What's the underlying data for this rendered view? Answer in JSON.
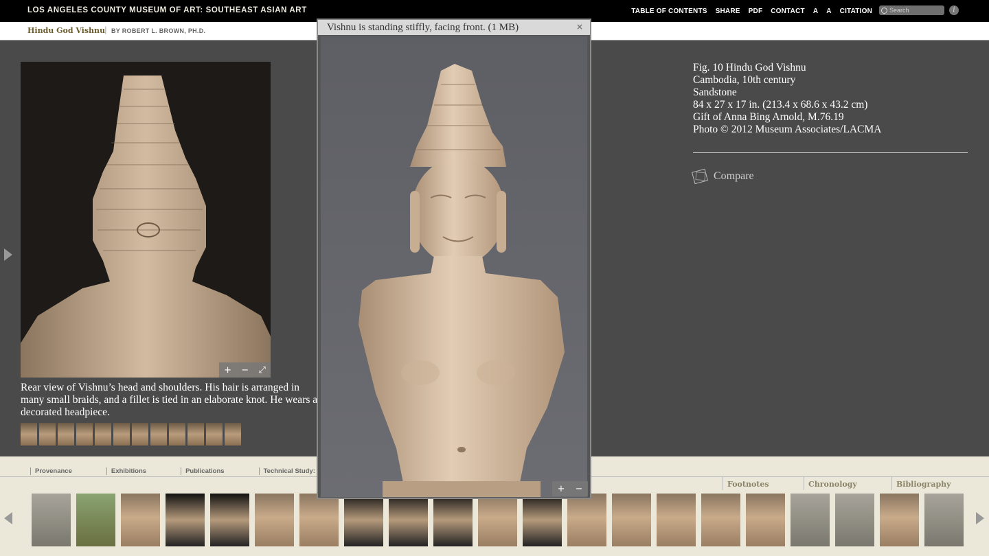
{
  "topbar": {
    "site_title": "LOS ANGELES COUNTY MUSEUM OF ART: SOUTHEAST ASIAN ART",
    "nav": [
      "TABLE OF CONTENTS",
      "SHARE",
      "PDF",
      "CONTACT",
      "A",
      "A",
      "CITATION"
    ],
    "search_placeholder": "Search",
    "info_label": "i"
  },
  "subheader": {
    "title": "Hindu God Vishnu",
    "separator": "|",
    "author": "BY ROBERT L. BROWN, PH.D."
  },
  "main": {
    "caption": "Rear view of Vishnu’s head and shoulders. His hair is arranged in many small braids, and a fillet is tied in an elaborate knot. He wears a decorated headpiece.",
    "zoom_in_icon": "+",
    "zoom_out_icon": "−",
    "fullscreen_icon": "⤢"
  },
  "figure": {
    "lines": [
      "Fig. 10 Hindu God Vishnu",
      "Cambodia, 10th century",
      "Sandstone",
      "84 x 27 x 17 in. (213.4 x 68.6 x 43.2 cm)",
      "Gift of Anna Bing Arnold, M.76.19",
      "Photo © 2012 Museum Associates/LACMA"
    ],
    "compare_label": "Compare"
  },
  "bottom": {
    "tabs_left": [
      "Provenance",
      "Exhibitions",
      "Publications",
      "Technical Study: Hindu"
    ],
    "tabs_right": [
      "Footnotes",
      "Chronology",
      "Bibliography"
    ]
  },
  "popup": {
    "title": "Vishnu is standing stiffly, facing front. (1 MB)",
    "close_label": "×"
  },
  "colors": {
    "background": "#4a4a4a",
    "topbar": "#000000",
    "bottom_panel": "#ebe8da",
    "accent_title": "#6b5d2e"
  }
}
